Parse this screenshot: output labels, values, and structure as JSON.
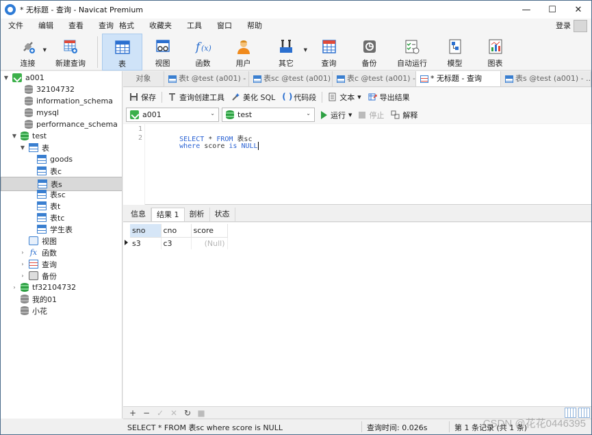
{
  "window": {
    "title": "* 无标题 - 查询 - Navicat Premium",
    "minimize": "—",
    "maximize": "☐",
    "close": "✕"
  },
  "menubar": {
    "items": [
      "文件",
      "编辑",
      "查看",
      "查询",
      "格式",
      "收藏夹",
      "工具",
      "窗口",
      "帮助"
    ],
    "login": "登录"
  },
  "toolbar": {
    "items": [
      {
        "label": "连接",
        "icon": "plug-icon"
      },
      {
        "label": "新建查询",
        "icon": "new-query-icon"
      },
      {
        "label": "表",
        "icon": "table-icon"
      },
      {
        "label": "视图",
        "icon": "view-icon"
      },
      {
        "label": "函数",
        "icon": "function-icon"
      },
      {
        "label": "用户",
        "icon": "user-icon"
      },
      {
        "label": "其它",
        "icon": "tools-icon"
      },
      {
        "label": "查询",
        "icon": "query-icon"
      },
      {
        "label": "备份",
        "icon": "backup-icon"
      },
      {
        "label": "自动运行",
        "icon": "automation-icon"
      },
      {
        "label": "模型",
        "icon": "model-icon"
      },
      {
        "label": "图表",
        "icon": "chart-icon"
      }
    ]
  },
  "sidebar": {
    "items": [
      {
        "label": "a001",
        "level": 0,
        "icon": "connection-icon"
      },
      {
        "label": "32104732",
        "level": 1,
        "icon": "database-icon"
      },
      {
        "label": "information_schema",
        "level": 1,
        "icon": "database-icon"
      },
      {
        "label": "mysql",
        "level": 1,
        "icon": "database-icon"
      },
      {
        "label": "performance_schema",
        "level": 1,
        "icon": "database-icon"
      },
      {
        "label": "test",
        "level": 1,
        "icon": "database-open-icon"
      },
      {
        "label": "表",
        "level": 2,
        "icon": "table-group-icon"
      },
      {
        "label": "goods",
        "level": 3,
        "icon": "table-icon"
      },
      {
        "label": "表c",
        "level": 3,
        "icon": "table-icon"
      },
      {
        "label": "表s",
        "level": 3,
        "icon": "table-icon"
      },
      {
        "label": "表sc",
        "level": 3,
        "icon": "table-icon"
      },
      {
        "label": "表t",
        "level": 3,
        "icon": "table-icon"
      },
      {
        "label": "表tc",
        "level": 3,
        "icon": "table-icon"
      },
      {
        "label": "学生表",
        "level": 3,
        "icon": "table-icon"
      },
      {
        "label": "视图",
        "level": 2,
        "icon": "view-icon"
      },
      {
        "label": "函数",
        "level": 2,
        "icon": "function-icon"
      },
      {
        "label": "查询",
        "level": 2,
        "icon": "query-icon"
      },
      {
        "label": "备份",
        "level": 2,
        "icon": "backup-icon"
      },
      {
        "label": "tf32104732",
        "level": 1,
        "icon": "database-open-icon"
      },
      {
        "label": "我的01",
        "level": 1,
        "icon": "database-icon"
      },
      {
        "label": "小花",
        "level": 1,
        "icon": "database-icon"
      }
    ]
  },
  "tabs": [
    {
      "label": "对象"
    },
    {
      "label": "表t @test (a001) - ..."
    },
    {
      "label": "表sc @test (a001) ..."
    },
    {
      "label": "表c @test (a001) - ..."
    },
    {
      "label": "* 无标题 - 查询"
    },
    {
      "label": "表s @test (a001) - ..."
    }
  ],
  "query_toolbar": {
    "save": "保存",
    "builder": "查询创建工具",
    "beautify": "美化 SQL",
    "snippet": "代码段",
    "text": "文本",
    "export": "导出结果"
  },
  "selectors": {
    "connection": "a001",
    "database": "test",
    "run": "运行",
    "stop": "停止",
    "explain": "解释"
  },
  "editor": {
    "lines": [
      {
        "num": "1",
        "parts": [
          [
            "kw",
            "SELECT"
          ],
          [
            "id",
            " * "
          ],
          [
            "kw",
            "FROM"
          ],
          [
            "id",
            " 表sc"
          ]
        ]
      },
      {
        "num": "2",
        "parts": [
          [
            "kw",
            "where"
          ],
          [
            "id",
            " score "
          ],
          [
            "kw",
            "is"
          ],
          [
            "id",
            " "
          ],
          [
            "kw",
            "NULL"
          ]
        ]
      }
    ]
  },
  "result_tabs": [
    "信息",
    "结果 1",
    "剖析",
    "状态"
  ],
  "grid": {
    "columns": [
      "sno",
      "cno",
      "score"
    ],
    "rows": [
      [
        "s3",
        "c3",
        "(Null)"
      ]
    ]
  },
  "grid_toolbar": [
    "+",
    "−",
    "✓",
    "✕",
    "↻",
    "■"
  ],
  "status": {
    "sql": "SELECT * FROM 表sc where score is NULL",
    "time": "查询时间: 0.026s",
    "record": "第 1 条记录 (共 1 条)"
  },
  "watermark": "CSDN @花花0446395",
  "colors": {
    "accent": "#2a62d3",
    "active_toolbar": "#cfe3f8",
    "run_green": "#2ea043"
  }
}
